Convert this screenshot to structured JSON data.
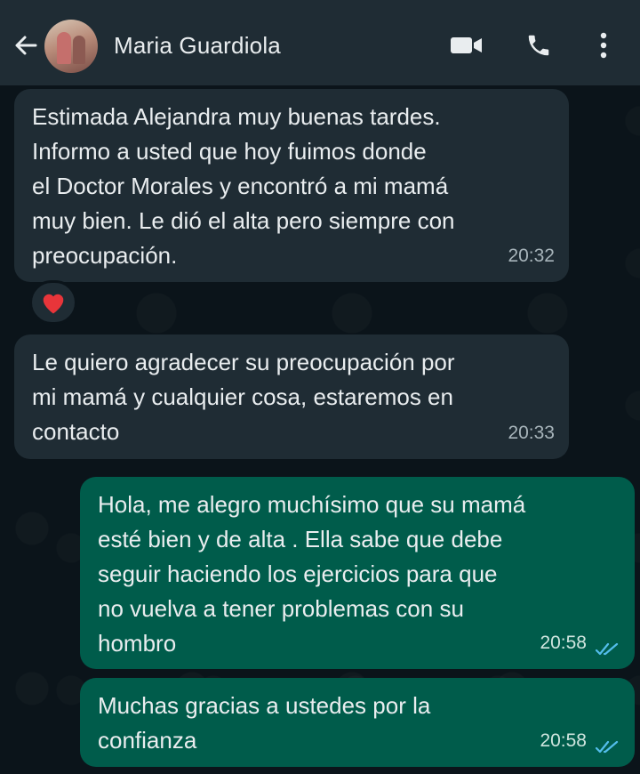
{
  "header": {
    "contact_name": "Maria Guardiola",
    "back_icon": "arrow-left-icon",
    "video_icon": "video-camera-icon",
    "call_icon": "phone-icon",
    "menu_icon": "more-vert-icon"
  },
  "messages": [
    {
      "direction": "incoming",
      "text": "Estimada Alejandra muy buenas tardes.\nInformo a usted que hoy fuimos donde\nel Doctor Morales y encontró a mi mamá\nmuy bien. Le dió el alta pero siempre con\npreocupación.",
      "time": "20:32",
      "reaction": "❤"
    },
    {
      "direction": "incoming",
      "text": "Le quiero agradecer su preocupación por\nmi mamá y cualquier cosa, estaremos en\ncontacto",
      "time": "20:33"
    },
    {
      "direction": "outgoing",
      "text": "Hola, me alegro muchísimo que su mamá\nesté bien y de alta . Ella sabe que debe\nseguir haciendo los ejercicios para que\nno vuelva a tener problemas con su\nhombro",
      "time": "20:58",
      "status": "read"
    },
    {
      "direction": "outgoing",
      "text": "Muchas gracias a ustedes por la\nconfianza",
      "time": "20:58",
      "status": "read"
    }
  ],
  "colors": {
    "header_bg": "#1f2c34",
    "incoming_bubble": "#1f2c34",
    "outgoing_bubble": "#005c4b",
    "read_ticks": "#53bdeb"
  }
}
